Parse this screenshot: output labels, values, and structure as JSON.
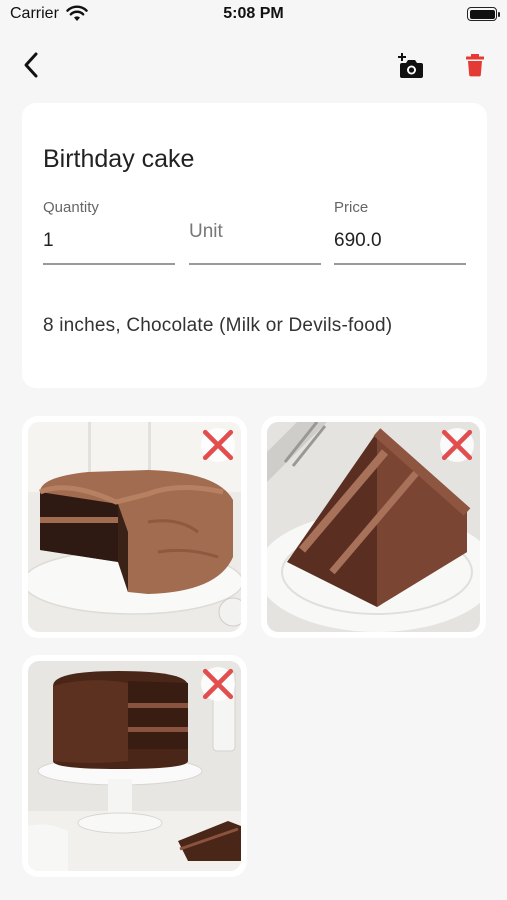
{
  "status_bar": {
    "carrier": "Carrier",
    "time": "5:08 PM",
    "battery_level": 1.0
  },
  "header": {
    "back_icon": "chevron-left-icon",
    "add_photo_icon": "add-photo-icon",
    "delete_icon": "trash-icon",
    "delete_color": "#e53935"
  },
  "item": {
    "name": "Birthday cake",
    "quantity_label": "Quantity",
    "quantity_value": "1",
    "unit_placeholder": "Unit",
    "price_label": "Price",
    "price_value": "690.0",
    "description": "8 inches, Chocolate (Milk or Devils-food)"
  },
  "photos": [
    {
      "subject": "whole chocolate cake with slice removed",
      "remove_icon": "close-icon"
    },
    {
      "subject": "slice of chocolate layer cake on plate",
      "remove_icon": "close-icon"
    },
    {
      "subject": "chocolate layer cake on cake stand",
      "remove_icon": "close-icon"
    }
  ],
  "colors": {
    "background": "#f6f6f6",
    "card": "#ffffff",
    "remove_x": "#e24d4d"
  }
}
